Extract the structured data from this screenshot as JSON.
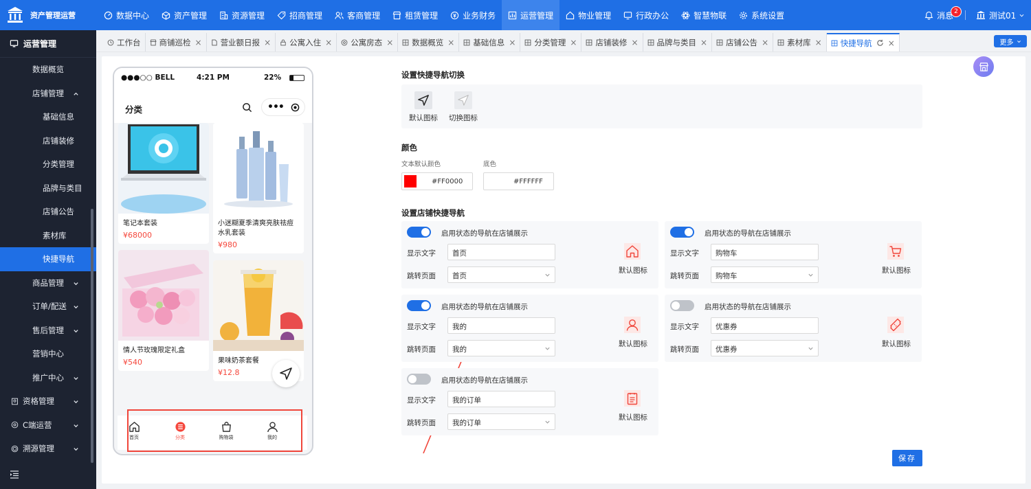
{
  "app": {
    "brand": "资产管理运营"
  },
  "topnav": [
    {
      "label": "数据中心",
      "icon": "dashboard-icon"
    },
    {
      "label": "资产管理",
      "icon": "cube-icon"
    },
    {
      "label": "资源管理",
      "icon": "building-icon"
    },
    {
      "label": "招商管理",
      "icon": "tag-icon"
    },
    {
      "label": "客商管理",
      "icon": "users-icon"
    },
    {
      "label": "租赁管理",
      "icon": "store-icon"
    },
    {
      "label": "业务财务",
      "icon": "coin-icon"
    },
    {
      "label": "运营管理",
      "icon": "chart-icon",
      "active": true
    },
    {
      "label": "物业管理",
      "icon": "home-icon"
    },
    {
      "label": "行政办公",
      "icon": "monitor-icon"
    },
    {
      "label": "智慧物联",
      "icon": "atom-icon"
    },
    {
      "label": "系统设置",
      "icon": "gear-icon"
    }
  ],
  "header": {
    "messages": "消息",
    "message_count": "2",
    "user": "测试01"
  },
  "sidebar": {
    "title": "运营管理",
    "items": [
      {
        "label": "数据概览",
        "level": 1
      },
      {
        "label": "店铺管理",
        "level": 1,
        "chevron": "up"
      },
      {
        "label": "基础信息",
        "level": 2
      },
      {
        "label": "店铺装修",
        "level": 2
      },
      {
        "label": "分类管理",
        "level": 2
      },
      {
        "label": "品牌与类目",
        "level": 2
      },
      {
        "label": "店铺公告",
        "level": 2
      },
      {
        "label": "素材库",
        "level": 2
      },
      {
        "label": "快捷导航",
        "level": 2,
        "active": true
      },
      {
        "label": "商品管理",
        "level": 1,
        "chevron": "down"
      },
      {
        "label": "订单/配送",
        "level": 1,
        "chevron": "down"
      },
      {
        "label": "售后管理",
        "level": 1,
        "chevron": "down"
      },
      {
        "label": "营销中心",
        "level": 1
      },
      {
        "label": "推广中心",
        "level": 1,
        "chevron": "down"
      },
      {
        "label": "资格管理",
        "level": 0,
        "chevron": "down"
      },
      {
        "label": "C端运营",
        "level": 0,
        "chevron": "down"
      },
      {
        "label": "溯源管理",
        "level": 0,
        "chevron": "down"
      }
    ]
  },
  "tabs": [
    {
      "label": "工作台",
      "close": false
    },
    {
      "label": "商铺巡检"
    },
    {
      "label": "营业额日报"
    },
    {
      "label": "公寓入住"
    },
    {
      "label": "公寓房态"
    },
    {
      "label": "数据概览"
    },
    {
      "label": "基础信息"
    },
    {
      "label": "分类管理"
    },
    {
      "label": "店铺装修"
    },
    {
      "label": "品牌与类目"
    },
    {
      "label": "店铺公告"
    },
    {
      "label": "素材库"
    },
    {
      "label": "快捷导航",
      "active": true
    }
  ],
  "tabs_more": "更多",
  "phone": {
    "carrier": "●●●○○ BELL",
    "time": "4:21 PM",
    "battery": "22%",
    "title": "分类",
    "capsule_dots": "•••",
    "products": [
      {
        "name": "笔记本套装",
        "price": "¥68000"
      },
      {
        "name": "小迷糊夏季清爽亮肤祛痘水乳套装",
        "price": "¥980"
      },
      {
        "name": "情人节玫瑰限定礼盒",
        "price": "¥540"
      },
      {
        "name": "果味奶茶套餐",
        "price": "¥12.8"
      }
    ],
    "tabbar": [
      {
        "label": "首页"
      },
      {
        "label": "分类",
        "active": true
      },
      {
        "label": "购物袋"
      },
      {
        "label": "我的"
      }
    ]
  },
  "settings": {
    "switch_title": "设置快捷导航切换",
    "icon_default": "默认图标",
    "icon_switch": "切换图标",
    "color_title": "颜色",
    "text_color_label": "文本默认颜色",
    "text_color": "#FF0000",
    "bg_label": "底色",
    "bg_color": "#FFFFFF",
    "nav_title": "设置店铺快捷导航",
    "toggle_label": "启用状态的导航在店铺展示",
    "display_label": "显示文字",
    "jump_label": "跳转页面",
    "default_icon_label": "默认图标",
    "navs": [
      {
        "enabled": true,
        "text": "首页",
        "page": "首页",
        "icon": "home-icon"
      },
      {
        "enabled": true,
        "text": "购物车",
        "page": "购物车",
        "icon": "cart-icon"
      },
      {
        "enabled": true,
        "text": "我的",
        "page": "我的",
        "icon": "user-icon"
      },
      {
        "enabled": false,
        "text": "优惠券",
        "page": "优惠券",
        "icon": "coupon-icon"
      },
      {
        "enabled": false,
        "text": "我的订单",
        "page": "我的订单",
        "icon": "order-icon"
      }
    ],
    "save": "保存"
  },
  "colors": {
    "primary": "#1f6fe5",
    "sidebar": "#1d2331",
    "price": "#f5473c",
    "annotation": "#f0453a"
  }
}
